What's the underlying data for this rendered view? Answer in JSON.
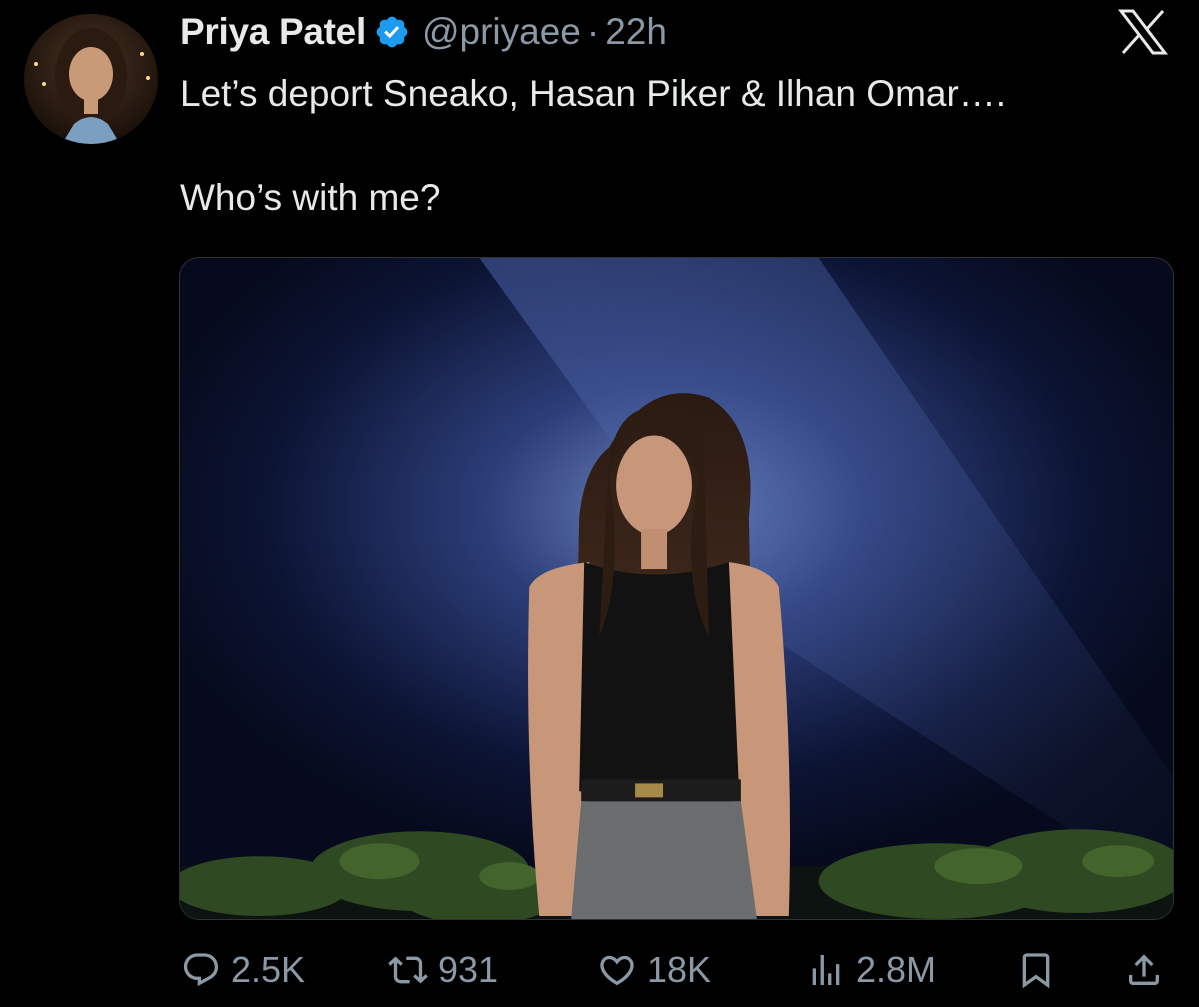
{
  "author": {
    "display_name": "Priya Patel",
    "handle": "@priyaee",
    "separator": "·",
    "time": "22h",
    "verified": true,
    "verified_color": "#1d9bf0"
  },
  "tweet": {
    "lines": [
      "Let’s deport Sneako, Hasan Piker & Ilhan Omar….",
      "Who’s with me?"
    ]
  },
  "platform_logo": "x-logo",
  "media": {
    "type": "photo",
    "description_icon": "photo-of-woman-against-dark-blue-backdrop"
  },
  "actions": {
    "replies": "2.5K",
    "reposts": "931",
    "likes": "18K",
    "views": "2.8M"
  },
  "colors": {
    "background": "#000000",
    "primary_text": "#e7e9ea",
    "secondary_text": "#8b98a5",
    "accent": "#1d9bf0"
  }
}
